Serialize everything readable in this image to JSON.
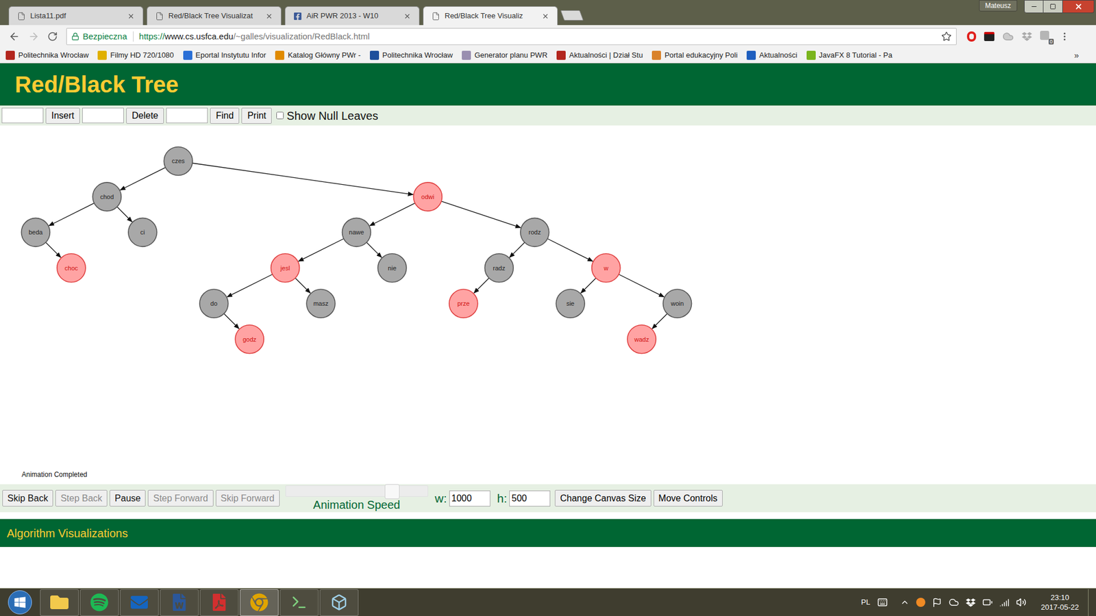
{
  "window": {
    "user": "Mateusz"
  },
  "tabs": [
    {
      "label": "Lista11.pdf",
      "selected": false,
      "kind": "pdf"
    },
    {
      "label": "Red/Black Tree Visualizat",
      "selected": false,
      "kind": "page"
    },
    {
      "label": "AiR PWR 2013 - W10",
      "selected": false,
      "kind": "facebook"
    },
    {
      "label": "Red/Black Tree Visualiz",
      "selected": true,
      "kind": "page"
    }
  ],
  "address_bar": {
    "security": "Bezpieczna",
    "scheme": "https://",
    "host": "www.cs.usfca.edu",
    "path": "/~galles/visualization/RedBlack.html",
    "bookmarked": false,
    "extension_badge": "0"
  },
  "bookmarks": [
    {
      "label": "Politechnika Wrocław",
      "color": "#b3261e"
    },
    {
      "label": "Filmy HD 720/1080",
      "color": "#e0b000"
    },
    {
      "label": "Eportal Instytutu Infor",
      "color": "#2a6fd6"
    },
    {
      "label": "Katalog Główny PWr -",
      "color": "#e08a00"
    },
    {
      "label": "Politechnika Wrocław",
      "color": "#1e4f9c"
    },
    {
      "label": "Generator planu PWR",
      "color": "#9a8fb0"
    },
    {
      "label": "Aktualności | Dział Stu",
      "color": "#b3261e"
    },
    {
      "label": "Portal edukacyjny Poli",
      "color": "#d9822b"
    },
    {
      "label": "Aktualności",
      "color": "#1f5fbf"
    },
    {
      "label": "JavaFX 8 Tutorial - Pa",
      "color": "#7ab51d"
    }
  ],
  "bookmarks_more": "»",
  "page": {
    "title": "Red/Black Tree",
    "controls": {
      "insert_value": "",
      "insert": "Insert",
      "delete_value": "",
      "delete": "Delete",
      "find_value": "",
      "find": "Find",
      "print": "Print",
      "show_null_leaves": {
        "label": "Show Null Leaves",
        "checked": false
      }
    },
    "status": "Animation Completed",
    "tree": {
      "label": "czes",
      "kind": "black",
      "color": "#a8a8a8",
      "left": {
        "label": "chod",
        "kind": "black",
        "color": "#a8a8a8",
        "left": {
          "label": "beda",
          "kind": "black",
          "color": "#a8a8a8",
          "right": {
            "label": "choc",
            "kind": "red",
            "color": "#ffa3a3"
          }
        },
        "right": {
          "label": "ci",
          "kind": "black",
          "color": "#a8a8a8"
        }
      },
      "right": {
        "label": "odwi",
        "kind": "red",
        "color": "#ffa3a3",
        "left": {
          "label": "nawe",
          "kind": "black",
          "color": "#a8a8a8",
          "left": {
            "label": "jesl",
            "kind": "red",
            "color": "#ffa3a3",
            "left": {
              "label": "do",
              "kind": "black",
              "color": "#a8a8a8",
              "right": {
                "label": "godz",
                "kind": "red",
                "color": "#ffa3a3"
              }
            },
            "right": {
              "label": "masz",
              "kind": "black",
              "color": "#a8a8a8"
            }
          },
          "right": {
            "label": "nie",
            "kind": "black",
            "color": "#a8a8a8"
          }
        },
        "right": {
          "label": "rodz",
          "kind": "black",
          "color": "#a8a8a8",
          "left": {
            "label": "radz",
            "kind": "black",
            "color": "#a8a8a8",
            "left": {
              "label": "prze",
              "kind": "red",
              "color": "#ffa3a3"
            }
          },
          "right": {
            "label": "w",
            "kind": "red",
            "color": "#ffa3a3",
            "left": {
              "label": "sie",
              "kind": "black",
              "color": "#a8a8a8"
            },
            "right": {
              "label": "woin",
              "kind": "black",
              "color": "#a8a8a8",
              "left": {
                "label": "wadz",
                "kind": "red",
                "color": "#ffa3a3"
              }
            }
          }
        }
      }
    },
    "animation": {
      "buttons": [
        {
          "label": "Skip Back",
          "disabled": false
        },
        {
          "label": "Step Back",
          "disabled": true
        },
        {
          "label": "Pause",
          "disabled": false
        },
        {
          "label": "Step Forward",
          "disabled": true
        },
        {
          "label": "Skip Forward",
          "disabled": true
        }
      ],
      "speed_label": "Animation Speed",
      "speed_level": 0.75,
      "width_label": "w:",
      "width": "1000",
      "height_label": "h:",
      "height": "500",
      "resize": "Change Canvas Size",
      "move": "Move Controls"
    },
    "footer": "Algorithm Visualizations"
  },
  "taskbar": {
    "apps": [
      {
        "kind": "explorer",
        "active": false
      },
      {
        "kind": "spotify",
        "active": false
      },
      {
        "kind": "outlook",
        "active": false
      },
      {
        "kind": "word",
        "active": false
      },
      {
        "kind": "acrobat",
        "active": false
      },
      {
        "kind": "chrome",
        "active": true
      },
      {
        "kind": "terminal",
        "active": false
      },
      {
        "kind": "notes",
        "active": false
      }
    ],
    "language": "PL",
    "time": "23:10",
    "date": "2017-05-22"
  }
}
